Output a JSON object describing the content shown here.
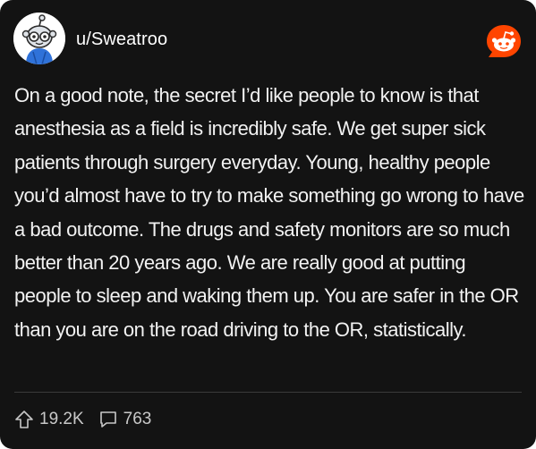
{
  "post": {
    "username": "u/Sweatroo",
    "avatar_icon": "snoo-avatar-icon",
    "platform_icon": "reddit-logo-icon",
    "text": "On a good note, the secret I’d like people to know is that anesthesia as a field is incredibly safe. We get super sick patients through surgery everyday. Young, healthy people you’d almost have to try to make something go wrong to have a bad outcome. The drugs and safety monitors are so much better than 20 years ago. We are really good at putting people to sleep and waking them up. You are safer in the OR than you are on the road driving to the OR, statistically."
  },
  "stats": {
    "upvotes": "19.2K",
    "upvote_icon": "upvote-arrow-icon",
    "comments": "763",
    "comment_icon": "comment-bubble-icon"
  },
  "colors": {
    "background": "#131313",
    "text": "#f2f2f2",
    "muted": "#c8c8c8",
    "reddit_orange": "#ff4500",
    "avatar_blue": "#2f72d9"
  }
}
